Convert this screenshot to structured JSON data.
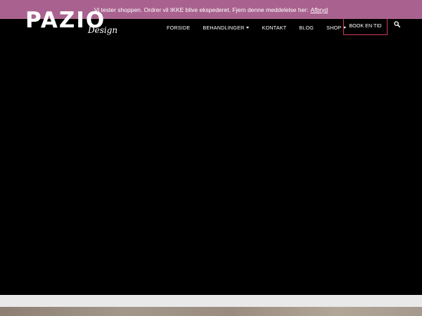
{
  "notice": {
    "text": "Vi tester shoppen. Ordrer vil IKKE blive ekspederet. Fjern denne meddelelse her:",
    "dismiss_link": "Afbryd"
  },
  "logo": {
    "main": "PAZIO",
    "sub": "Design"
  },
  "nav": {
    "items": [
      {
        "label": "FORSIDE"
      },
      {
        "label": "BEHANDLINGER"
      },
      {
        "label": "KONTAKT"
      },
      {
        "label": "BLOG"
      },
      {
        "label": "SHOP"
      }
    ],
    "book_label": "BOOK EN TID",
    "search_icon": "search-icon"
  },
  "colors": {
    "notice_bg": "#a9628f",
    "book_border": "#d23a5a",
    "background": "#000000"
  }
}
